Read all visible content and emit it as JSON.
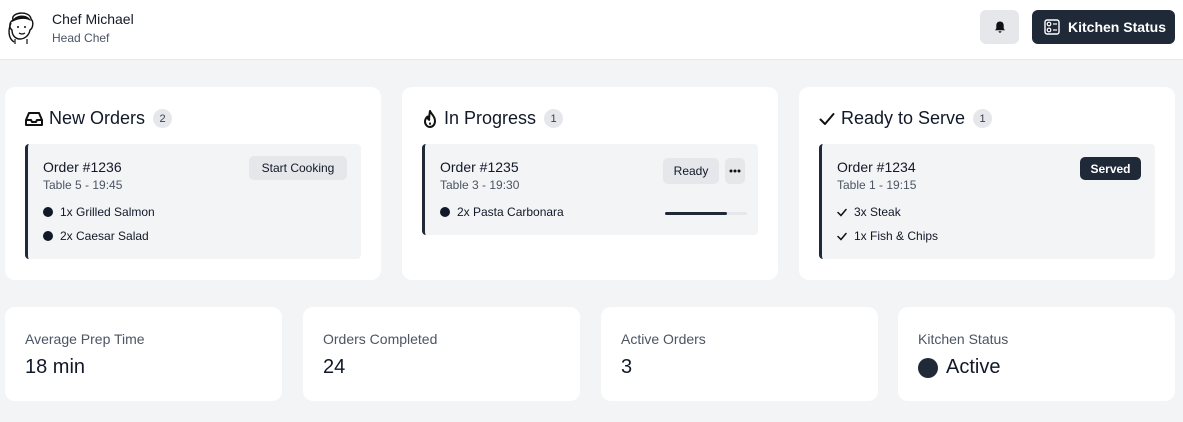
{
  "header": {
    "user_name": "Chef Michael",
    "user_role": "Head Chef",
    "kitchen_status_button": "Kitchen Status"
  },
  "columns": [
    {
      "title": "New Orders",
      "count": "2",
      "icon": "inbox-icon",
      "order": {
        "id": "Order #1236",
        "meta": "Table 5 - 19:45",
        "action": "Start Cooking",
        "items": [
          "1x Grilled Salmon",
          "2x Caesar Salad"
        ]
      }
    },
    {
      "title": "In Progress",
      "count": "1",
      "icon": "flame-icon",
      "order": {
        "id": "Order #1235",
        "meta": "Table 3 - 19:30",
        "action": "Ready",
        "progress": 0.75,
        "items": [
          "2x Pasta Carbonara"
        ]
      }
    },
    {
      "title": "Ready to Serve",
      "count": "1",
      "icon": "checkmark-icon",
      "order": {
        "id": "Order #1234",
        "meta": "Table 1 - 19:15",
        "action": "Served",
        "items": [
          "3x Steak",
          "1x Fish & Chips"
        ]
      }
    }
  ],
  "stats": [
    {
      "label": "Average Prep Time",
      "value": "18 min"
    },
    {
      "label": "Orders Completed",
      "value": "24"
    },
    {
      "label": "Active Orders",
      "value": "3"
    },
    {
      "label": "Kitchen Status",
      "value": "Active"
    }
  ],
  "colors": {
    "accent_dark": "#1f2937",
    "background": "#f3f4f6",
    "card": "#ffffff",
    "muted_button": "#e5e7eb"
  }
}
